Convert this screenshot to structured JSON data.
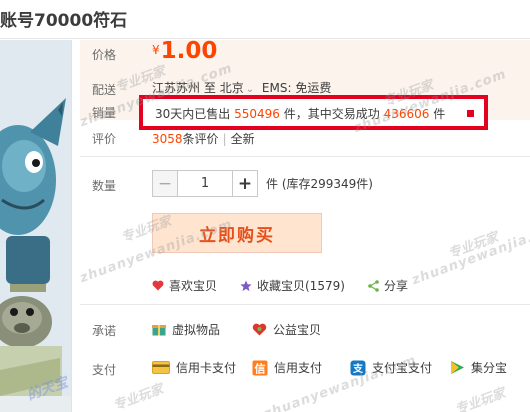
{
  "title": "账号70000符石",
  "labels": {
    "price": "价格",
    "shipping": "配送",
    "sales": "销量",
    "rating": "评价",
    "quantity": "数量",
    "promise": "承诺",
    "payment": "支付"
  },
  "price": {
    "currency": "¥",
    "amount": "1.00"
  },
  "shipping": {
    "from": "江苏苏州",
    "to_word": "至",
    "to": "北京",
    "fee": "EMS: 免运费"
  },
  "sales": {
    "prefix": "30天内已售出",
    "sold": "550496",
    "mid": "件，其中交易成功",
    "success": "436606",
    "suffix": "件"
  },
  "rating": {
    "count": "3058",
    "count_suffix": "条评价",
    "sep": "|",
    "points": "全新"
  },
  "quantity": {
    "minus": "−",
    "value": "1",
    "plus": "+",
    "stock": "件 (库存299349件)"
  },
  "buy_button": "立即购买",
  "social": {
    "like": "喜欢宝贝",
    "favorite": "收藏宝贝(1579)",
    "share": "分享"
  },
  "promise": {
    "virtual": "虚拟物品",
    "charity": "公益宝贝"
  },
  "payment": {
    "credit_card": "信用卡支付",
    "credit": "信用支付",
    "alipay": "支付宝支付",
    "jifen": "集分宝"
  },
  "watermark": {
    "cn": "专业玩家",
    "en": "zhuanyewanjia.com",
    "side": "的天宝"
  },
  "colors": {
    "accent": "#ff4400",
    "highlight_border": "#e4001f",
    "buy_bg": "#ffe4d0",
    "buy_text": "#e5511d"
  },
  "icons": [
    "heart-icon",
    "star-icon",
    "share-icon",
    "gift-icon",
    "charity-heart-icon",
    "credit-card-icon",
    "credit-icon",
    "alipay-icon",
    "jifen-icon"
  ]
}
